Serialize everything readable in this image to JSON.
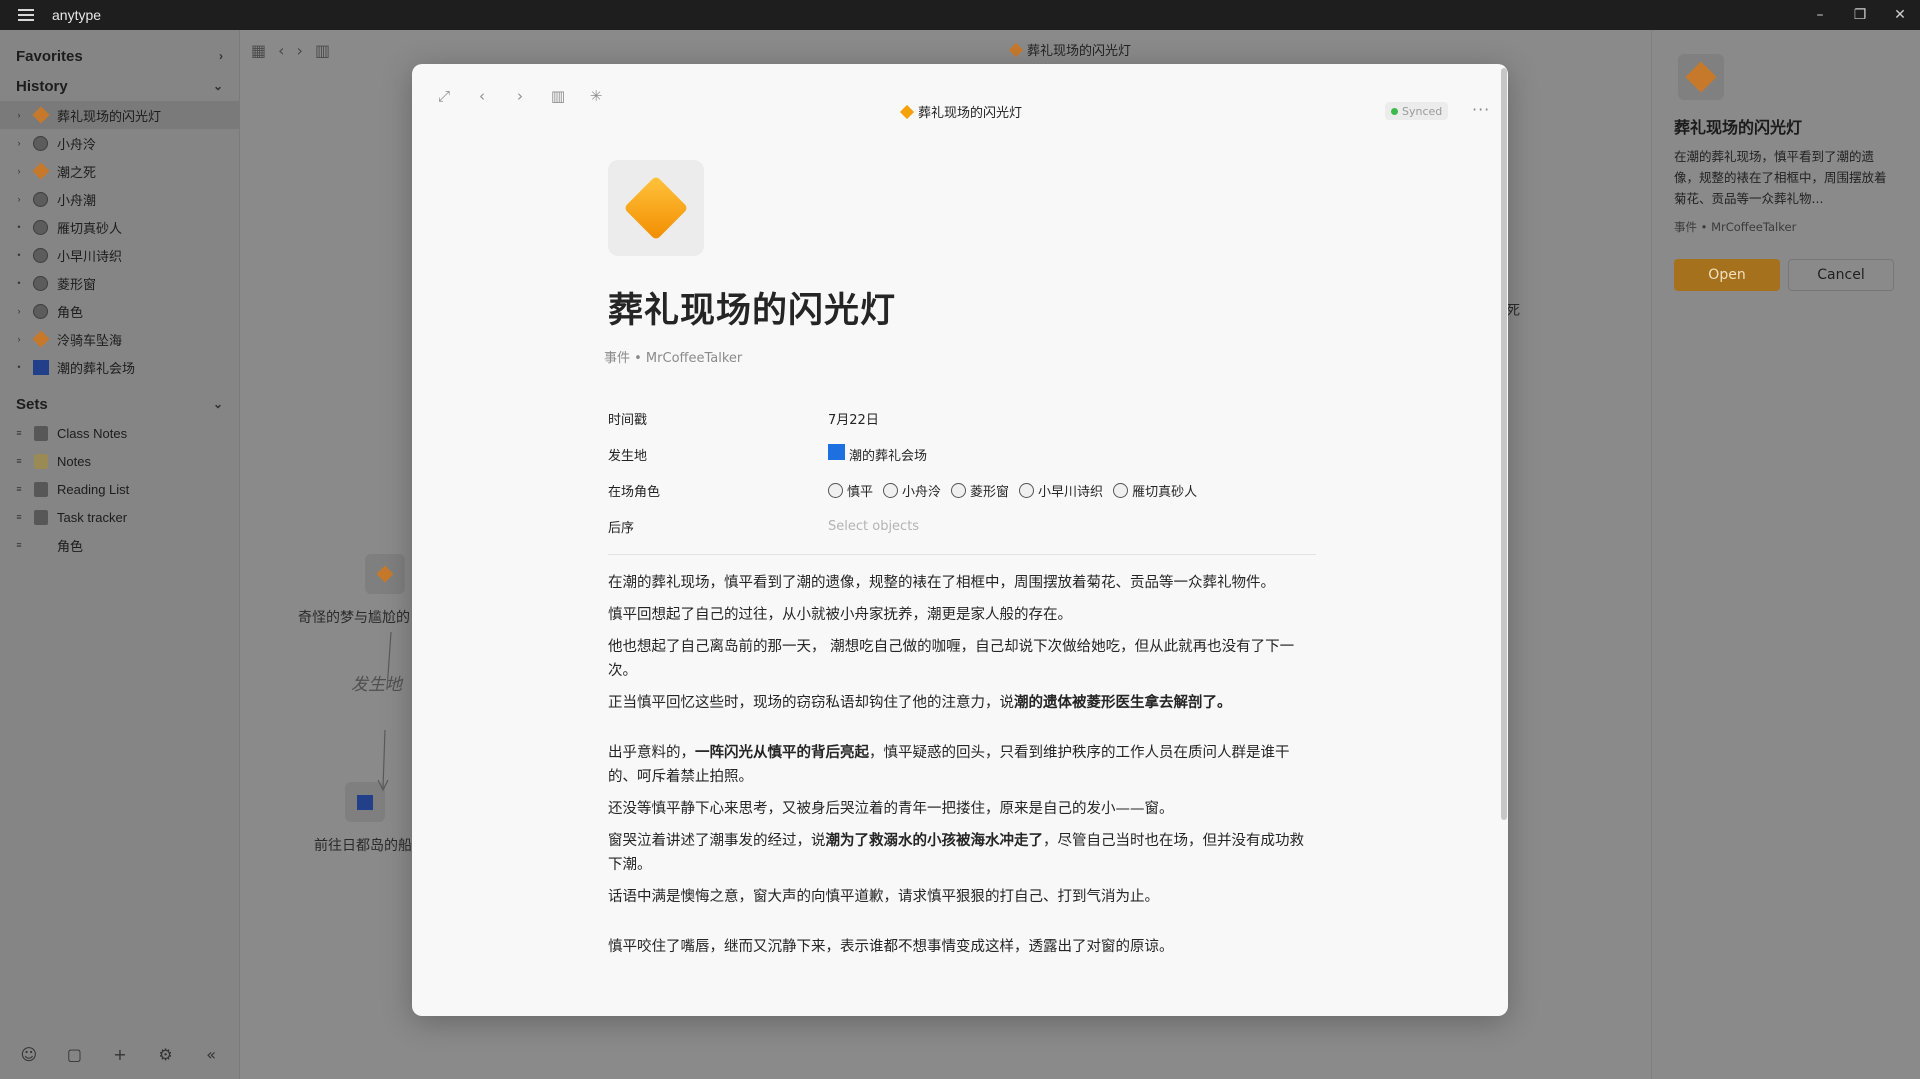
{
  "app": {
    "name": "anytype"
  },
  "sidebar": {
    "favorites_label": "Favorites",
    "history_label": "History",
    "history": [
      {
        "label": "葬礼现场的闪光灯",
        "icon": "diamond",
        "expand": "›",
        "active": true
      },
      {
        "label": "小舟泠",
        "icon": "avatar",
        "expand": "›"
      },
      {
        "label": "潮之死",
        "icon": "diamond",
        "expand": "›"
      },
      {
        "label": "小舟潮",
        "icon": "avatar",
        "expand": "›"
      },
      {
        "label": "雁切真砂人",
        "icon": "avatar",
        "expand": "•"
      },
      {
        "label": "小早川诗织",
        "icon": "avatar",
        "expand": "•"
      },
      {
        "label": "菱形窗",
        "icon": "avatar",
        "expand": "•"
      },
      {
        "label": "角色",
        "icon": "avatar",
        "expand": "›"
      },
      {
        "label": "泠骑车坠海",
        "icon": "diamond",
        "expand": "›"
      },
      {
        "label": "潮的葬礼会场",
        "icon": "square",
        "expand": "•"
      }
    ],
    "sets_label": "Sets",
    "sets": [
      {
        "label": "Class Notes",
        "icon": "book"
      },
      {
        "label": "Notes",
        "icon": "note"
      },
      {
        "label": "Reading List",
        "icon": "book"
      },
      {
        "label": "Task tracker",
        "icon": "book"
      },
      {
        "label": "角色",
        "icon": "none"
      }
    ]
  },
  "main": {
    "title": "葬礼现场的闪光灯",
    "graph": {
      "node1_label": "奇怪的梦与尴尬的",
      "edge_label": "发生地",
      "node2_label": "前往日都岛的船",
      "right_edge_char": "死"
    }
  },
  "right_panel": {
    "title": "葬礼现场的闪光灯",
    "description": "在潮的葬礼现场，慎平看到了潮的遗像，规整的裱在了相框中，周围摆放着菊花、贡品等一众葬礼物...",
    "meta": "事件 • MrCoffeeTalker",
    "open_label": "Open",
    "cancel_label": "Cancel"
  },
  "modal": {
    "header_title": "葬礼现场的闪光灯",
    "synced_label": "Synced",
    "more_label": "···",
    "title": "葬礼现场的闪光灯",
    "meta": "事件 • MrCoffeeTalker",
    "props": {
      "timestamp_key": "时间戳",
      "timestamp_value": "7月22日",
      "location_key": "发生地",
      "location_value": "潮的葬礼会场",
      "characters_key": "在场角色",
      "characters": [
        "慎平",
        "小舟泠",
        "菱形窗",
        "小早川诗织",
        "雁切真砂人"
      ],
      "next_key": "后序",
      "next_placeholder": "Select objects"
    },
    "body": {
      "p1": "在潮的葬礼现场，慎平看到了潮的遗像，规整的裱在了相框中，周围摆放着菊花、贡品等一众葬礼物件。",
      "p2": "慎平回想起了自己的过往，从小就被小舟家抚养，潮更是家人般的存在。",
      "p3": "他也想起了自己离岛前的那一天， 潮想吃自己做的咖喱，自己却说下次做给她吃，但从此就再也没有了下一次。",
      "p4_a": "正当慎平回忆这些时，现场的窃窃私语却钩住了他的注意力，说",
      "p4_b": "潮的遗体被菱形医生拿去解剖了。",
      "p5_a": "出乎意料的，",
      "p5_b": "一阵闪光从慎平的背后亮起",
      "p5_c": "，慎平疑惑的回头，只看到维护秩序的工作人员在质问人群是谁干的、呵斥着禁止拍照。",
      "p6": "还没等慎平静下心来思考，又被身后哭泣着的青年一把搂住，原来是自己的发小——窗。",
      "p7_a": "窗哭泣着讲述了潮事发的经过，说",
      "p7_b": "潮为了救溺水的小孩被海水冲走了",
      "p7_c": "，尽管自己当时也在场，但并没有成功救下潮。",
      "p8": "话语中满是懊悔之意，窗大声的向慎平道歉，请求慎平狠狠的打自己、打到气消为止。",
      "p9": "慎平咬住了嘴唇，继而又沉静下来，表示谁都不想事情变成这样，透露出了对窗的原谅。"
    }
  }
}
